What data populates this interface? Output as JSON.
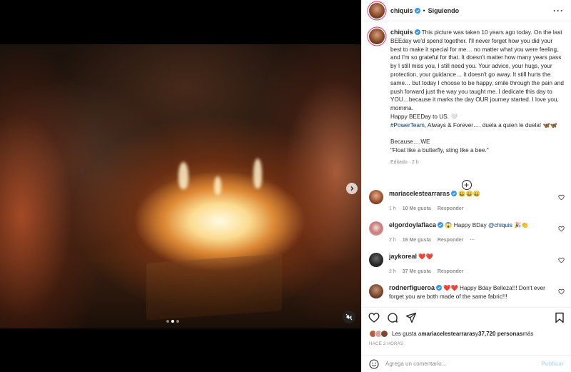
{
  "header": {
    "username": "chiquis",
    "separator": "•",
    "follow_status": "Siguiendo",
    "more": "···"
  },
  "caption": {
    "username": "chiquis",
    "lines": [
      "This picture was taken 10 years ago today. On the last BEEday we'd spend together. I'll never forget how you did your best to make it special for me… no matter what you were feeling, and I'm so grateful for that. It doesn't matter how many years pass by I still miss you, I still need you. Your advice, your hugs, your protection, your guidance… it doesn't go away. It still hurts the same… but today I choose to be happy, smile through the pain and push forward just the way you taught me. I dedicate this day to YOU…because it marks the day OUR journey started. I love you, momma."
    ],
    "line2": "Happy BEEDay to US. 🤍",
    "hashtag": "#PowerTeam",
    "line3_rest": ", Always & Forever…. duela a quien le duela! 🦋🦋",
    "line4": "Because….WE",
    "line5": "\"Float like a butterfly, sting like a bee.\"",
    "meta": "Editado · 2 h"
  },
  "comments": [
    {
      "username": "mariacelestearraras",
      "text": "😀😀😀",
      "time": "1 h",
      "likes": "10 Me gusta",
      "reply": "Responder"
    },
    {
      "username": "elgordoylaflaca",
      "text_pre": "😱 Happy BDay ",
      "mention": "@chiquis",
      "text_post": " 🎉👏",
      "time": "2 h",
      "likes": "16 Me gusta",
      "reply": "Responder",
      "more": "···"
    },
    {
      "username": "jaykoreal",
      "text": "❤️❤️",
      "time": "2 h",
      "likes": "37 Me gusta",
      "reply": "Responder"
    },
    {
      "username": "rodnerfigueroa",
      "text": "❤️❤️ Happy Bday Belleza!!! Don't ever forget you are both made of the same fabric!!!"
    }
  ],
  "likes": {
    "prefix": "Les gusta a ",
    "user": "mariacelestearraras",
    "middle": " y ",
    "count": "37,720 personas",
    "suffix": " más"
  },
  "time_ago": "HACE 2 HORAS",
  "comment_box": {
    "placeholder": "Agrega un comentario...",
    "publish": "Publicar"
  },
  "colors": {
    "verified": "#3897f0",
    "link": "#00376b",
    "muted": "#8e8e8e",
    "publish_disabled": "#b2dffc"
  }
}
